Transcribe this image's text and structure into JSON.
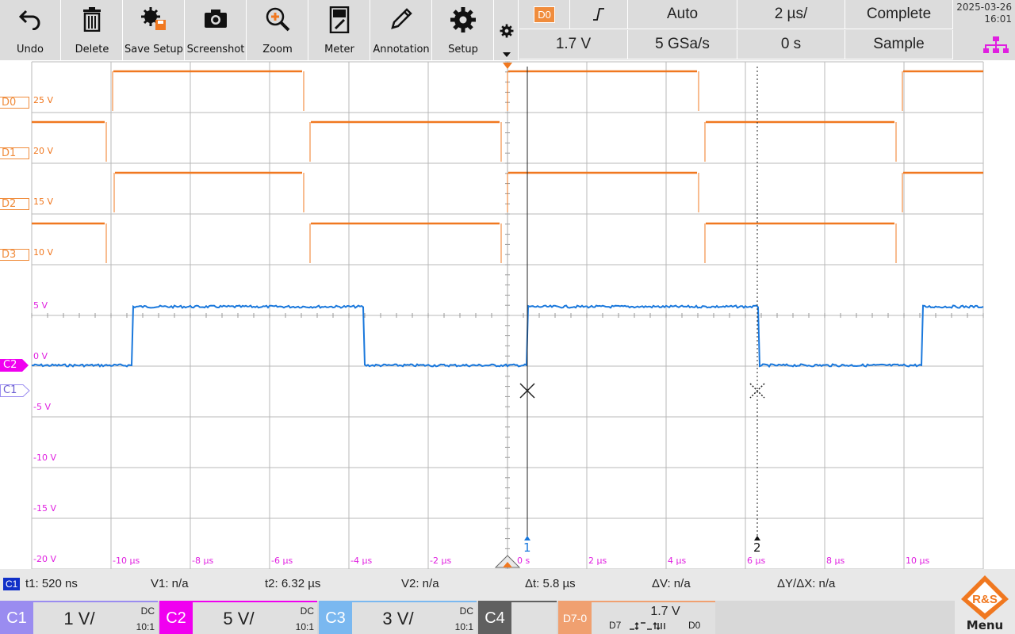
{
  "toolbar": {
    "buttons": [
      {
        "label": "Undo",
        "icon": "undo-icon"
      },
      {
        "label": "Delete",
        "icon": "trash-icon"
      },
      {
        "label": "Save Setup",
        "icon": "save-setup-icon"
      },
      {
        "label": "Screenshot",
        "icon": "camera-icon"
      },
      {
        "label": "Zoom",
        "icon": "zoom-icon"
      },
      {
        "label": "Meter",
        "icon": "meter-icon"
      },
      {
        "label": "Annotation",
        "icon": "pen-icon"
      },
      {
        "label": "Setup",
        "icon": "gear-icon"
      }
    ]
  },
  "trigger": {
    "source": "D0",
    "slope": "rising-edge",
    "mode": "Auto",
    "timebase": "2 µs/",
    "acquisition": "Complete",
    "level": "1.7 V",
    "sample_rate": "5 GSa/s",
    "position": "0 s",
    "acq_mode": "Sample"
  },
  "datetime": {
    "date": "2025-03-26",
    "time": "16:01"
  },
  "lanes": [
    {
      "label": "D0",
      "vlabel": "25 V"
    },
    {
      "label": "D1",
      "vlabel": "20 V"
    },
    {
      "label": "D2",
      "vlabel": "15 V"
    },
    {
      "label": "D3",
      "vlabel": "10 V"
    }
  ],
  "y_labels": [
    "5 V",
    "0 V",
    "-5 V",
    "-10 V",
    "-15 V",
    "-20 V"
  ],
  "x_labels": [
    "-10 µs",
    "-8 µs",
    "-6 µs",
    "-4 µs",
    "-2 µs",
    "0 s",
    "2 µs",
    "4 µs",
    "6 µs",
    "8 µs",
    "10 µs"
  ],
  "markers": {
    "c2": "C2",
    "c1": "C1",
    "cursor1": "1",
    "cursor2": "2"
  },
  "measurements": {
    "chan_tag": "C1",
    "t1": "t1: 520 ns",
    "v1": "V1: n/a",
    "t2": "t2: 6.32 µs",
    "v2": "V2: n/a",
    "dt": "Δt: 5.8 µs",
    "dv": "ΔV: n/a",
    "dydx": "ΔY/ΔX: n/a"
  },
  "channels": [
    {
      "name": "C1",
      "scale": "1 V/",
      "coupling": "DC",
      "probe": "10:1",
      "color": "#9a8cf0"
    },
    {
      "name": "C2",
      "scale": "5 V/",
      "coupling": "DC",
      "probe": "10:1",
      "color": "#f000f0"
    },
    {
      "name": "C3",
      "scale": "3 V/",
      "coupling": "DC",
      "probe": "10:1",
      "color": "#7ab8f0"
    },
    {
      "name": "C4",
      "color": "#606060"
    }
  ],
  "digital": {
    "name": "D7-0",
    "level": "1.7 V",
    "msb": "D7",
    "lsb": "D0",
    "color": "#f0a070"
  },
  "menu": {
    "label": "Menu",
    "logo": "R&S"
  },
  "colors": {
    "digital": "#f07820",
    "analog": "#1a78dc",
    "grid": "#b8b8b8"
  }
}
